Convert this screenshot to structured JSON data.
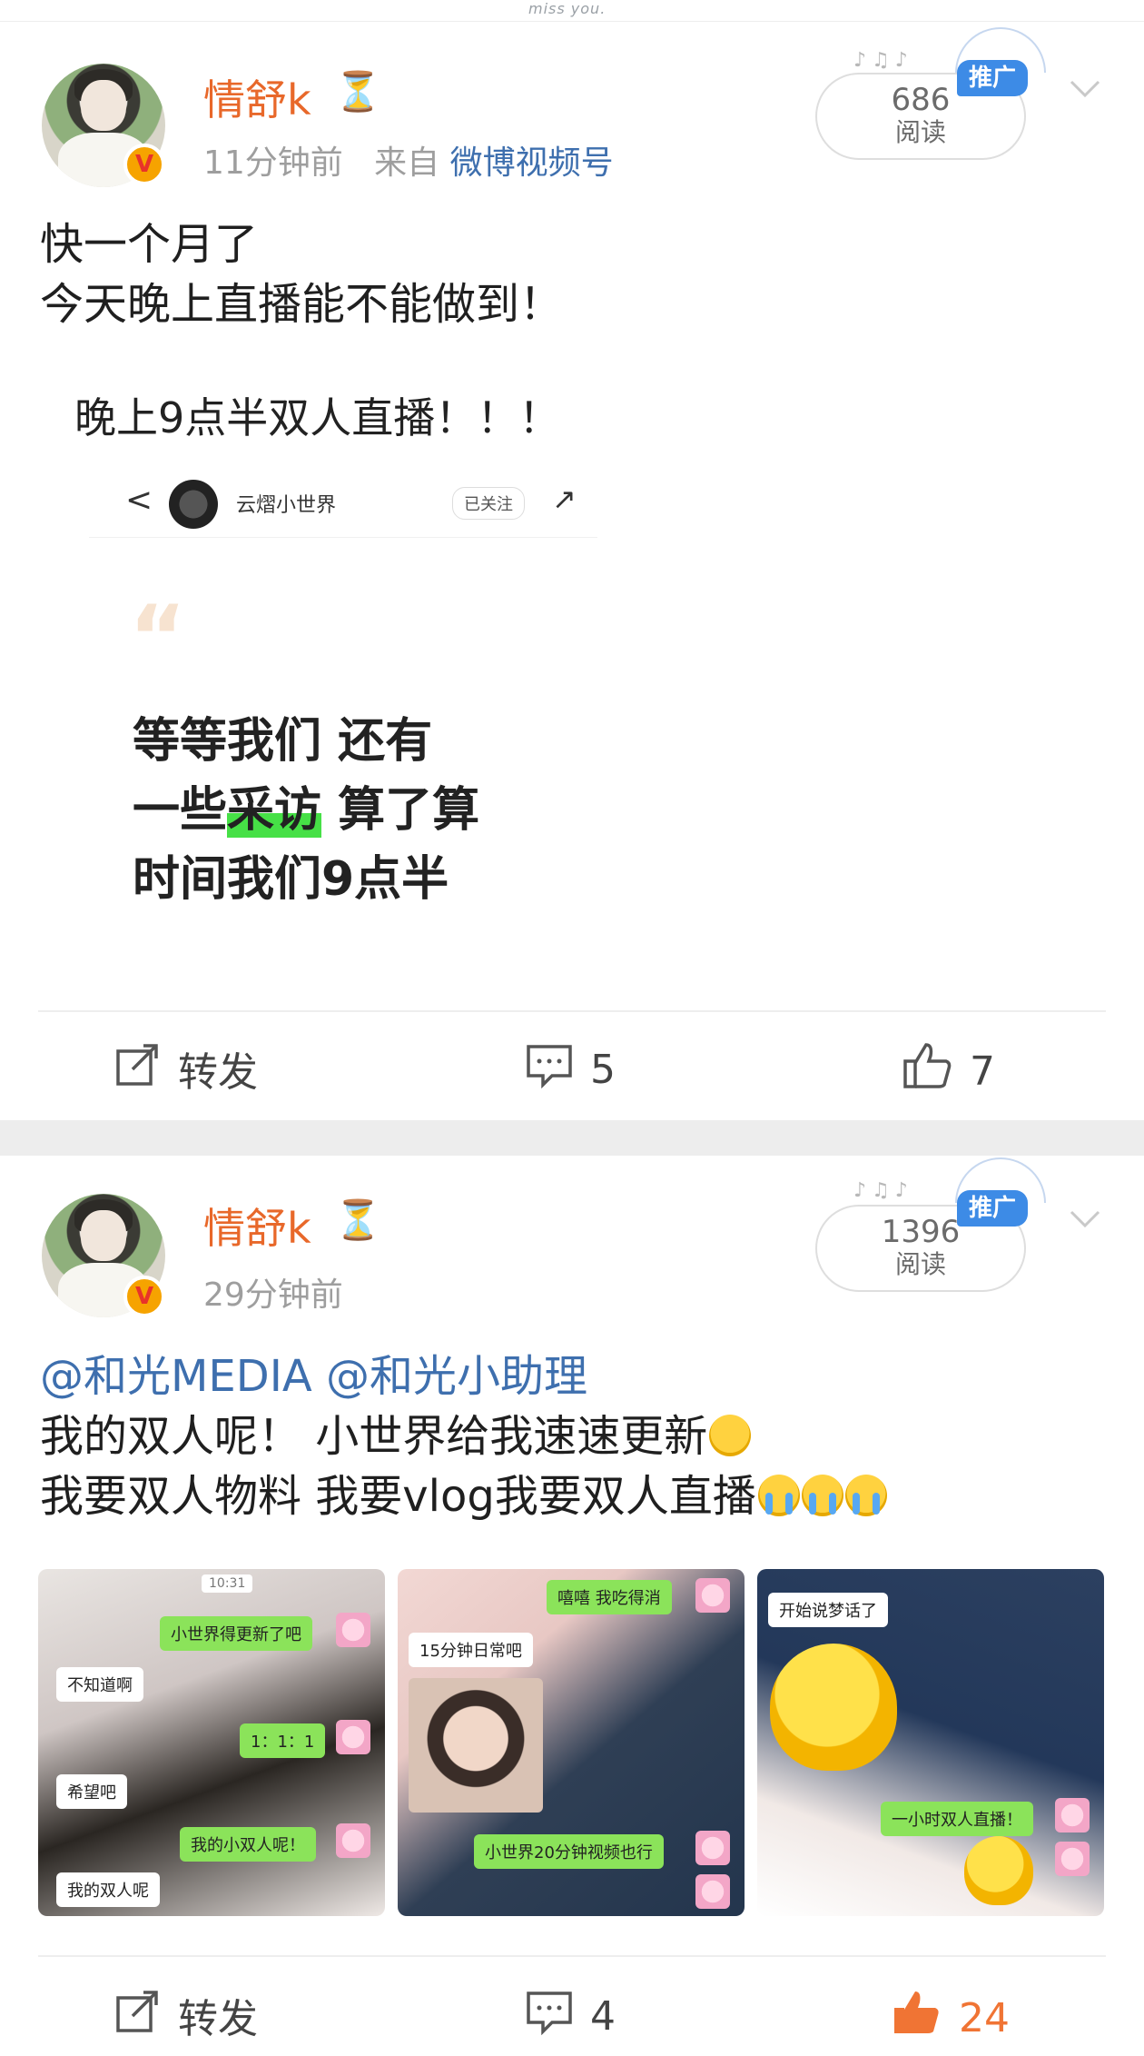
{
  "header": {
    "strip_text": "miss you."
  },
  "posts": [
    {
      "username": "情舒k",
      "status_icon": "hourglass-icon",
      "time": "11分钟前",
      "source_prefix": "来自",
      "source": "微博视频号",
      "reads_count": "686",
      "reads_label": "阅读",
      "promo_label": "推广",
      "lines": [
        "快一个月了",
        "今天晚上直播能不能做到！"
      ],
      "embed": {
        "caption": "晚上9点半双人直播！！！",
        "chat_back": "<",
        "chat_name": "云熠小世界",
        "chat_follow": "已关注",
        "quote_mark": "“",
        "quote_lines": [
          "等等我们 还有",
          "一些采访 算了算",
          "时间我们9点半"
        ],
        "highlight": "采访"
      },
      "actions": {
        "repost_label": "转发",
        "comments": "5",
        "likes": "7"
      }
    },
    {
      "username": "情舒k",
      "status_icon": "hourglass-icon",
      "time": "29分钟前",
      "reads_count": "1396",
      "reads_label": "阅读",
      "promo_label": "推广",
      "mentions": [
        "@和光MEDIA",
        "@和光小助理"
      ],
      "line2": "我的双人呢！ 小世界给我速速更新",
      "line3": "我要双人物料 我要vlog我要双人直播",
      "images": [
        {
          "time": "10:31",
          "bubbles": [
            "小世界得更新了吧",
            "不知道啊",
            "1：1：1",
            "希望吧",
            "我的小双人呢！",
            "我的双人呢"
          ]
        },
        {
          "bubbles": [
            "嘻嘻 我吃得消",
            "15分钟日常吧",
            "小世界20分钟视频也行"
          ]
        },
        {
          "bubbles": [
            "开始说梦话了",
            "一小时双人直播！"
          ]
        }
      ],
      "actions": {
        "repost_label": "转发",
        "comments": "4",
        "likes": "24"
      }
    }
  ],
  "colors": {
    "username": "#e8682a",
    "link": "#3e6fae",
    "liked": "#f07434",
    "promo": "#3d8be6"
  }
}
